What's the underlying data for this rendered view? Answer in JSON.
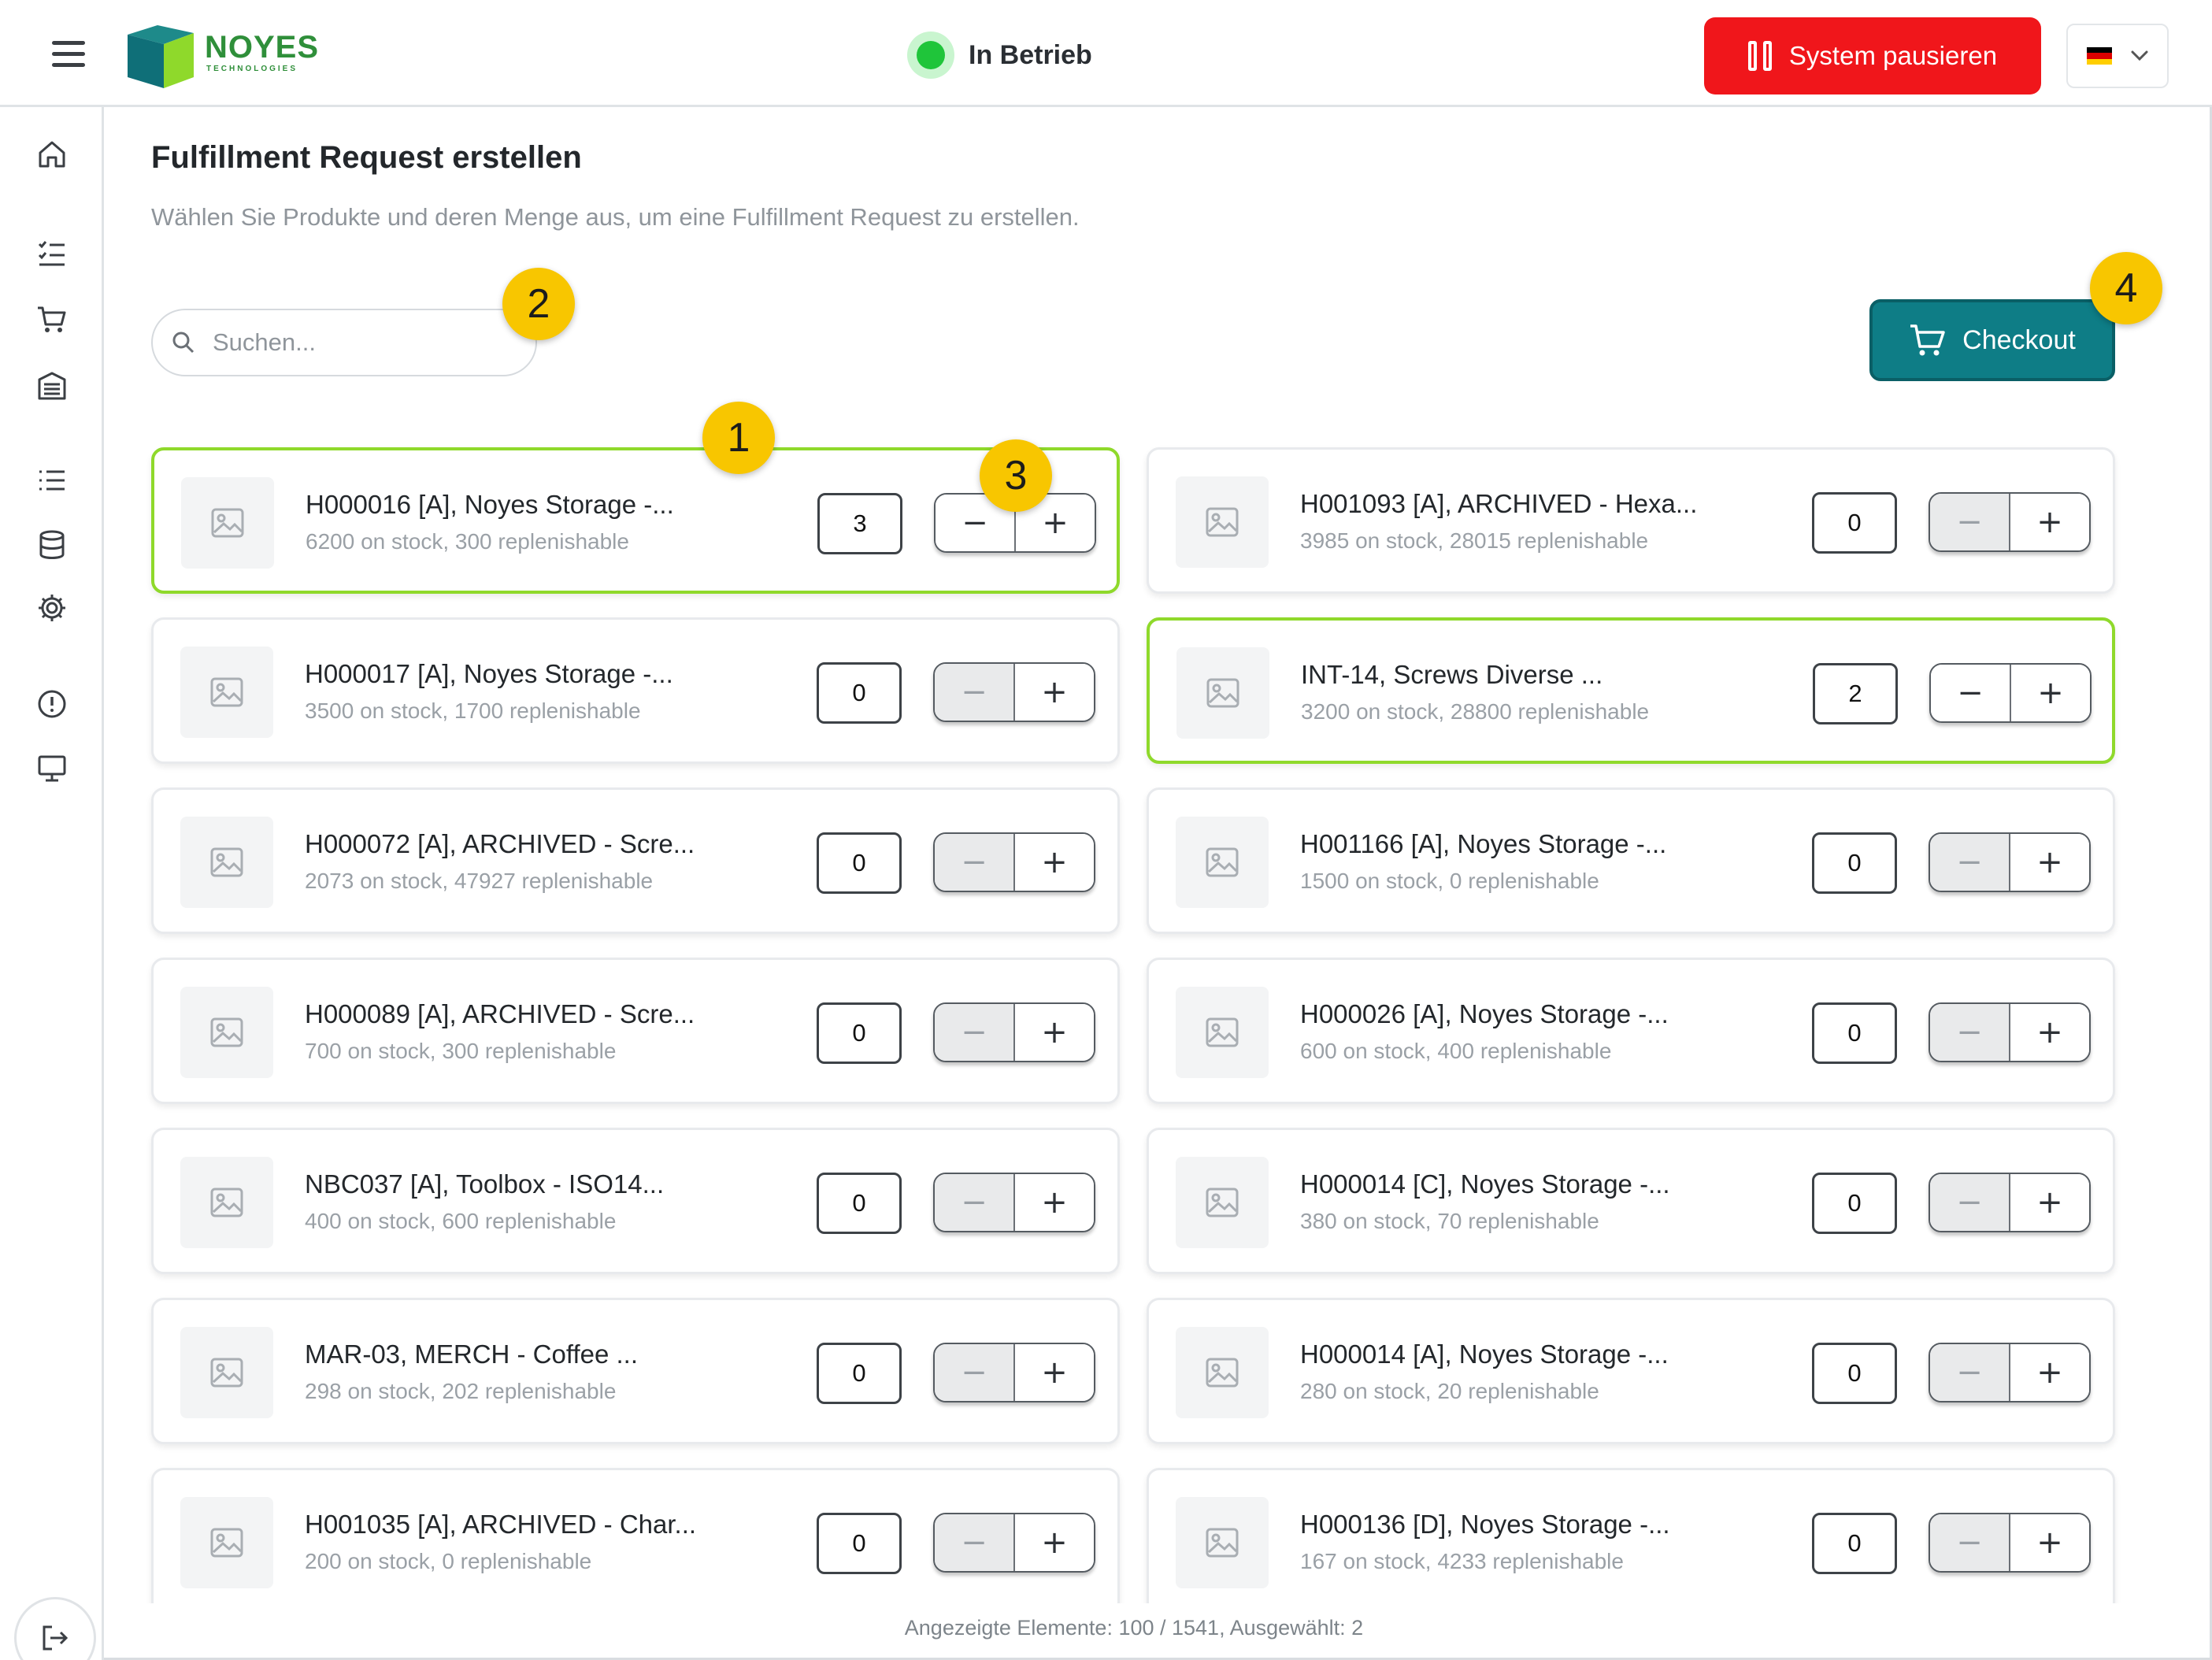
{
  "header": {
    "brand": "NOYES",
    "brand_sub": "TECHNOLOGIES",
    "status": "In Betrieb",
    "pause_label": "System pausieren",
    "language_flag": "de-flag-icon"
  },
  "colors": {
    "accent": "#0e7d86",
    "danger": "#f0161b",
    "status_ok": "#1fc53a",
    "selected_border": "#8fd92b",
    "badge": "#f8c600"
  },
  "sidebar": {
    "icons": [
      "home-icon",
      "task-list-icon",
      "cart-icon",
      "storage-icon",
      "list-icon",
      "database-icon",
      "gear-icon",
      "alert-icon",
      "monitor-icon"
    ],
    "logout": "logout-icon"
  },
  "main": {
    "title": "Fulfillment Request erstellen",
    "subtitle": "Wählen Sie Produkte und deren Menge aus, um eine Fulfillment Request zu erstellen.",
    "search_placeholder": "Suchen...",
    "checkout_label": "Checkout"
  },
  "badges": [
    "1",
    "2",
    "3",
    "4"
  ],
  "products": [
    {
      "name": "H000016 [A], Noyes Storage -...",
      "stock": "6200 on stock, 300 replenishable",
      "qty": "3",
      "selected": true
    },
    {
      "name": "H001093 [A], ARCHIVED - Hexa...",
      "stock": "3985 on stock, 28015 replenishable",
      "qty": "0",
      "selected": false
    },
    {
      "name": "H000017 [A], Noyes Storage -...",
      "stock": "3500 on stock, 1700 replenishable",
      "qty": "0",
      "selected": false
    },
    {
      "name": "INT-14, Screws Diverse ...",
      "stock": "3200 on stock, 28800 replenishable",
      "qty": "2",
      "selected": true
    },
    {
      "name": "H000072 [A], ARCHIVED - Scre...",
      "stock": "2073 on stock, 47927 replenishable",
      "qty": "0",
      "selected": false
    },
    {
      "name": "H001166 [A], Noyes Storage -...",
      "stock": "1500 on stock, 0 replenishable",
      "qty": "0",
      "selected": false
    },
    {
      "name": "H000089 [A], ARCHIVED - Scre...",
      "stock": "700 on stock, 300 replenishable",
      "qty": "0",
      "selected": false
    },
    {
      "name": "H000026 [A], Noyes Storage -...",
      "stock": "600 on stock, 400 replenishable",
      "qty": "0",
      "selected": false
    },
    {
      "name": "NBC037 [A], Toolbox - ISO14...",
      "stock": "400 on stock, 600 replenishable",
      "qty": "0",
      "selected": false
    },
    {
      "name": "H000014 [C], Noyes Storage -...",
      "stock": "380 on stock, 70 replenishable",
      "qty": "0",
      "selected": false
    },
    {
      "name": "MAR-03, MERCH - Coffee ...",
      "stock": "298 on stock, 202 replenishable",
      "qty": "0",
      "selected": false
    },
    {
      "name": "H000014 [A], Noyes Storage -...",
      "stock": "280 on stock, 20 replenishable",
      "qty": "0",
      "selected": false
    },
    {
      "name": "H001035 [A], ARCHIVED - Char...",
      "stock": "200 on stock, 0 replenishable",
      "qty": "0",
      "selected": false
    },
    {
      "name": "H000136 [D], Noyes Storage -...",
      "stock": "167 on stock, 4233 replenishable",
      "qty": "0",
      "selected": false
    }
  ],
  "footer": "Angezeigte Elemente: 100 / 1541, Ausgewählt: 2"
}
